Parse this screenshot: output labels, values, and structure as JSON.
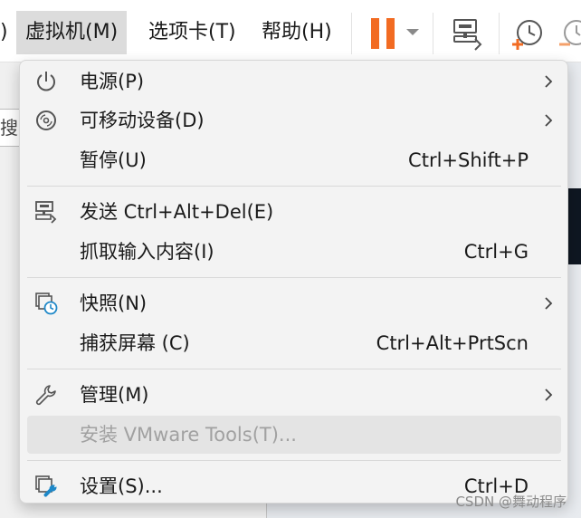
{
  "menubar": {
    "partial_label": ")",
    "vm_label": "虚拟机(M)",
    "tabs_label": "选项卡(T)",
    "help_label": "帮助(H)"
  },
  "menu": {
    "power": {
      "label": "电源(P)"
    },
    "removable": {
      "label": "可移动设备(D)"
    },
    "pause": {
      "label": "暂停(U)",
      "shortcut": "Ctrl+Shift+P"
    },
    "send_cad": {
      "label": "发送 Ctrl+Alt+Del(E)"
    },
    "grab_input": {
      "label": "抓取输入内容(I)",
      "shortcut": "Ctrl+G"
    },
    "snapshot": {
      "label": "快照(N)"
    },
    "capture_screen": {
      "label": "捕获屏幕 (C)",
      "shortcut": "Ctrl+Alt+PrtScn"
    },
    "manage": {
      "label": "管理(M)"
    },
    "install_tools": {
      "label": "安装 VMware Tools(T)...",
      "disabled": true
    },
    "settings": {
      "label": "设置(S)...",
      "shortcut": "Ctrl+D"
    }
  },
  "background": {
    "left_fragment": "搜"
  },
  "watermark": "CSDN @舞动程序",
  "colors": {
    "accent_orange": "#f26b22",
    "menu_bg": "#f3f3f3",
    "active_menu_bg": "#dcdcdc",
    "disabled_text": "#a1a1a1"
  },
  "icons": [
    "power-icon",
    "disc-icon",
    "send-keys-icon",
    "snapshot-icon",
    "wrench-icon",
    "settings-icon",
    "chevron-right-icon",
    "pause-icon",
    "dropdown-arrow-icon",
    "send-key-toolbar-icon",
    "snapshot-clock-icon"
  ]
}
